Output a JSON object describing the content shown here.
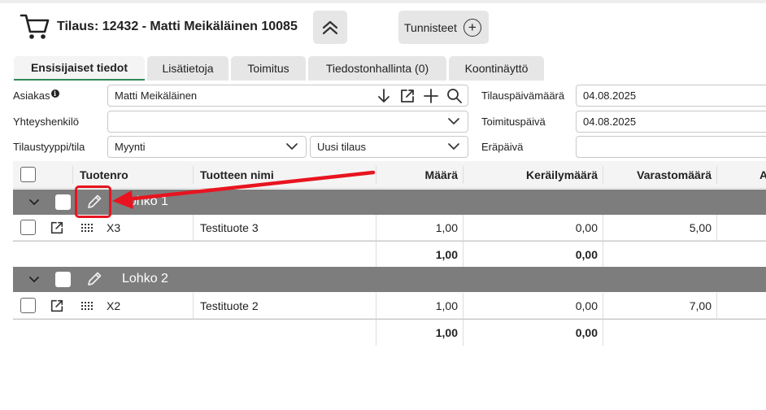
{
  "header": {
    "title": "Tilaus: 12432 - Matti Meikäläinen 10085",
    "tags_label": "Tunnisteet"
  },
  "tabs": [
    {
      "label": "Ensisijaiset tiedot",
      "active": true
    },
    {
      "label": "Lisätietoja",
      "active": false
    },
    {
      "label": "Toimitus",
      "active": false
    },
    {
      "label": "Tiedostonhallinta (0)",
      "active": false
    },
    {
      "label": "Koontinäyttö",
      "active": false
    }
  ],
  "form": {
    "customer_label": "Asiakas",
    "customer_value": "Matti Meikäläinen",
    "contact_label": "Yhteyshenkilö",
    "contact_value": "",
    "type_label": "Tilaustyyppi/tila",
    "type_value": "Myynti",
    "status_value": "Uusi tilaus",
    "order_date_label": "Tilauspäivämäärä",
    "order_date_value": "04.08.2025",
    "delivery_date_label": "Toimituspäivä",
    "delivery_date_value": "04.08.2025",
    "due_date_label": "Eräpäivä",
    "due_date_value": ""
  },
  "grid": {
    "columns": [
      "Tuotenro",
      "Tuotteen nimi",
      "Määrä",
      "Keräilymäärä",
      "Varastomäärä",
      "A"
    ],
    "groups": [
      {
        "name": "Lohko 1",
        "rows": [
          {
            "product_no": "X3",
            "product_name": "Testituote 3",
            "quantity": "1,00",
            "picking_qty": "0,00",
            "stock_qty": "5,00"
          }
        ],
        "total_quantity": "1,00",
        "total_picking": "0,00"
      },
      {
        "name": "Lohko 2",
        "rows": [
          {
            "product_no": "X2",
            "product_name": "Testituote 2",
            "quantity": "1,00",
            "picking_qty": "0,00",
            "stock_qty": "7,00"
          }
        ],
        "total_quantity": "1,00",
        "total_picking": "0,00"
      }
    ]
  },
  "colors": {
    "accent_green": "#2e8b57",
    "group_bar": "#7d7d7d",
    "annotation_red": "#e8141f"
  },
  "icons": [
    "cart-icon",
    "chevron-up-icon",
    "plus-circle-icon",
    "arrow-down-icon",
    "external-link-icon",
    "plus-icon",
    "search-icon",
    "chevron-down-icon",
    "pencil-icon",
    "drag-handle-icon",
    "info-icon"
  ]
}
